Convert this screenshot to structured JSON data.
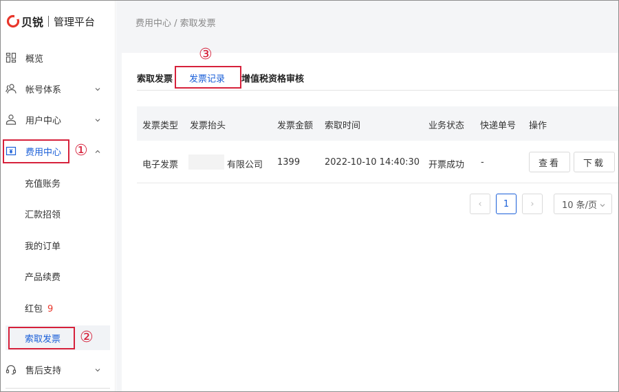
{
  "brand": {
    "name": "贝锐",
    "subtitle": "管理平台",
    "color": "#e8362b"
  },
  "sidebar": {
    "items": [
      {
        "label": "概览",
        "icon": "grid-icon"
      },
      {
        "label": "帐号体系",
        "icon": "users-icon",
        "expandable": true
      },
      {
        "label": "用户中心",
        "icon": "user-icon",
        "expandable": true
      },
      {
        "label": "费用中心",
        "icon": "invoice-icon",
        "expandable": true,
        "expanded": true
      },
      {
        "label": "售后支持",
        "icon": "headset-icon",
        "expandable": true
      }
    ],
    "sub_items": [
      {
        "label": "充值账务"
      },
      {
        "label": "汇款招领"
      },
      {
        "label": "我的订单"
      },
      {
        "label": "产品续费"
      },
      {
        "label": "红包",
        "badge": "9"
      },
      {
        "label": "索取发票",
        "active": true
      }
    ]
  },
  "breadcrumb": "费用中心 / 索取发票",
  "tabs": [
    {
      "label": "索取发票"
    },
    {
      "label": "发票记录",
      "active": true
    },
    {
      "label": "增值税资格审核"
    }
  ],
  "table": {
    "headers": [
      "发票类型",
      "发票抬头",
      "发票金额",
      "索取时间",
      "业务状态",
      "快递单号",
      "操作"
    ],
    "rows": [
      {
        "type": "电子发票",
        "title": "有限公司",
        "amount": "1399",
        "time": "2022-10-10 14:40:30",
        "status": "开票成功",
        "tracking": "-",
        "view_label": "查看",
        "download_label": "下载"
      }
    ]
  },
  "pagination": {
    "prev": "‹",
    "current": "1",
    "next": "›",
    "page_size": "10 条/页"
  },
  "annotations": {
    "step1": "①",
    "step2": "②",
    "step3": "③"
  },
  "colors": {
    "accent": "#1a5fd8",
    "annotation": "#d6203a"
  }
}
